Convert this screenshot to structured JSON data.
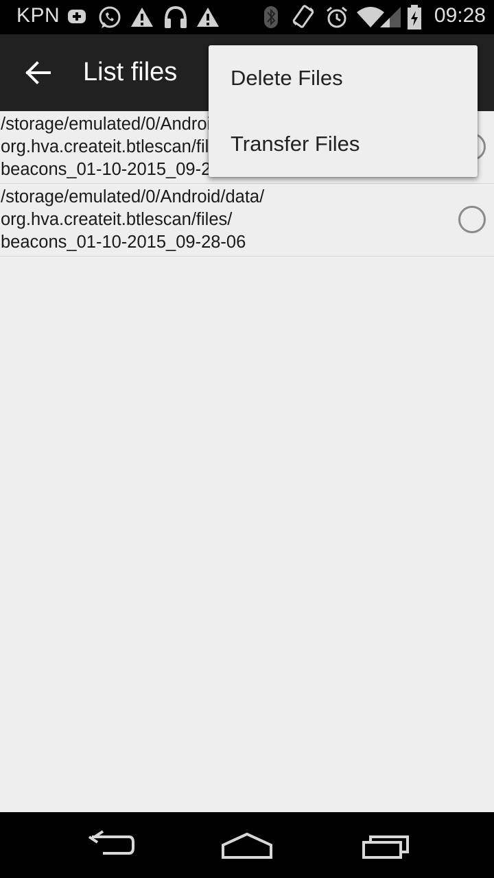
{
  "status_bar": {
    "carrier": "KPN",
    "time": "09:28",
    "icons": [
      "plus-box-icon",
      "whatsapp-icon",
      "warning-icon",
      "headphones-icon",
      "warning-icon",
      "bluetooth-icon",
      "vibrate-icon",
      "alarm-icon",
      "wifi-icon",
      "signal-icon",
      "battery-charging-icon"
    ]
  },
  "action_bar": {
    "title": "List files",
    "back_icon": "arrow-back-icon"
  },
  "files": [
    {
      "path": "/storage/emulated/0/Android/data/\norg.hva.createit.btlescan/files/\nbeacons_01-10-2015_09-28-06",
      "selected": false
    },
    {
      "path": "/storage/emulated/0/Android/data/\norg.hva.createit.btlescan/files/\nbeacons_01-10-2015_09-28-06",
      "selected": false
    }
  ],
  "menu": {
    "items": [
      "Delete Files",
      "Transfer Files"
    ]
  },
  "nav_bar": {
    "icons": [
      "back-icon",
      "home-icon",
      "recents-icon"
    ]
  },
  "colors": {
    "status_bar": "#000000",
    "action_bar": "#212121",
    "background": "#eeeeee",
    "menu_background": "#eeeeee"
  }
}
